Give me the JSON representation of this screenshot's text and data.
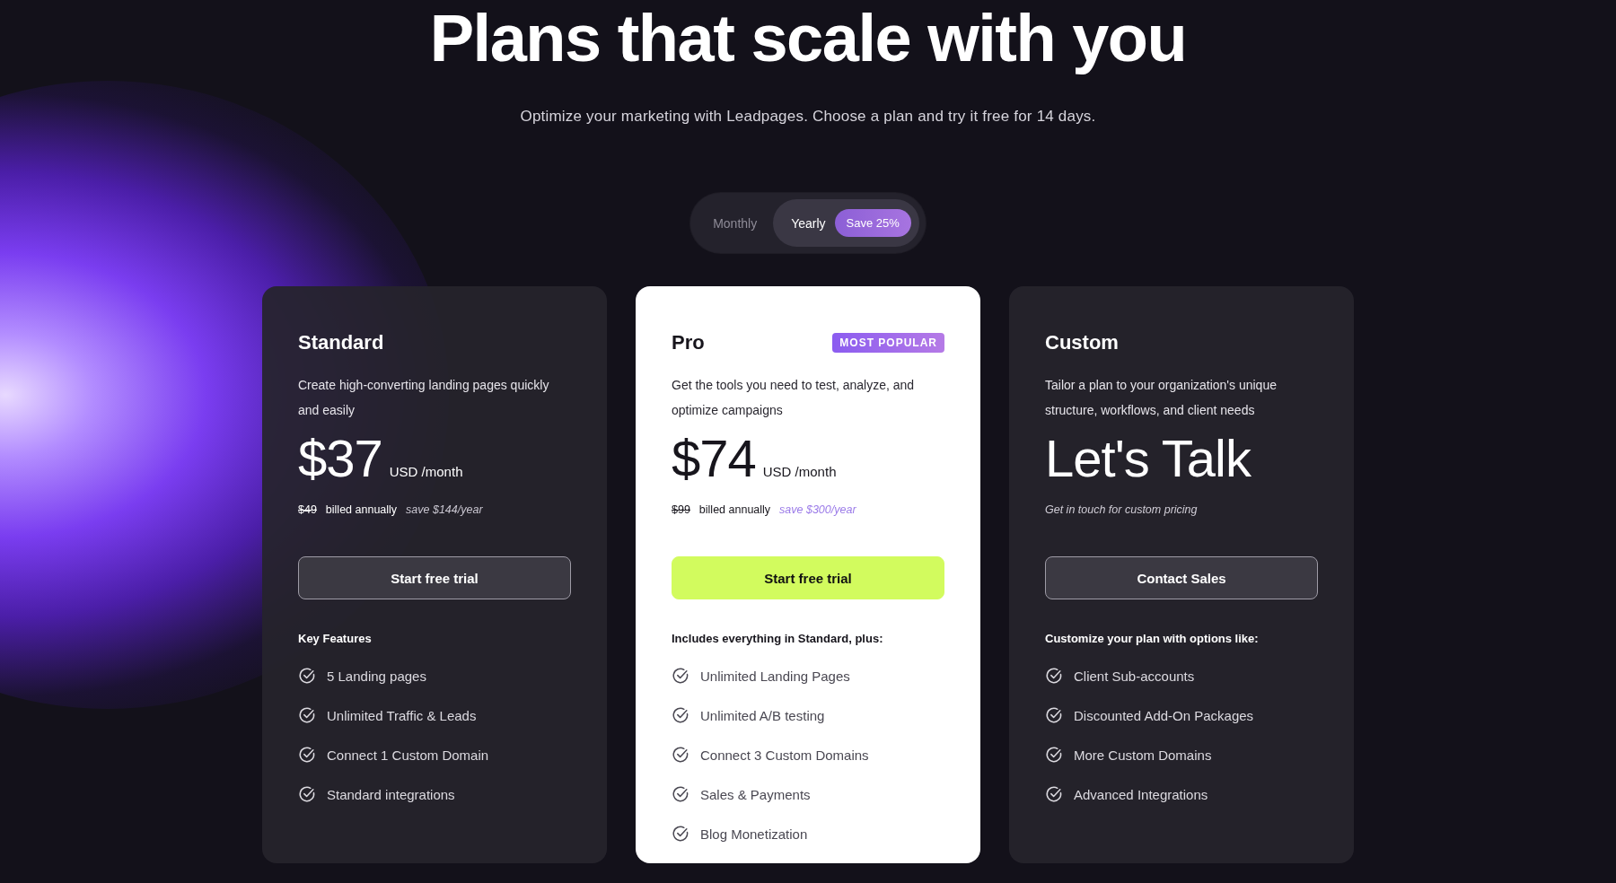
{
  "header": {
    "title": "Plans that scale with you",
    "subtitle": "Optimize your marketing with Leadpages. Choose a plan and try it free for 14 days."
  },
  "billing_toggle": {
    "options": [
      {
        "label": "Monthly",
        "selected": false
      },
      {
        "label": "Yearly",
        "selected": true
      }
    ],
    "badge": "Save 25%"
  },
  "plans": [
    {
      "kind": "priced",
      "featured": false,
      "name": "Standard",
      "description": "Create high-converting landing pages quickly and easily",
      "price": "$37",
      "price_unit": "USD /month",
      "original_price": "$49",
      "billing_note": "billed annually",
      "savings": "save $144/year",
      "cta": "Start free trial",
      "features_heading": "Key Features",
      "features": [
        "5 Landing pages",
        "Unlimited Traffic & Leads",
        "Connect 1 Custom Domain",
        "Standard integrations"
      ]
    },
    {
      "kind": "priced",
      "featured": true,
      "name": "Pro",
      "badge": "MOST POPULAR",
      "description": "Get the tools you need to test, analyze, and optimize campaigns",
      "price": "$74",
      "price_unit": "USD /month",
      "original_price": "$99",
      "billing_note": "billed annually",
      "savings": "save $300/year",
      "cta": "Start free trial",
      "features_heading": "Includes everything in Standard, plus:",
      "features": [
        "Unlimited Landing Pages",
        "Unlimited A/B testing",
        "Connect 3 Custom Domains",
        "Sales & Payments",
        "Blog Monetization"
      ]
    },
    {
      "kind": "contact",
      "featured": false,
      "name": "Custom",
      "description": "Tailor a plan to your organization's unique structure, workflows, and client needs",
      "price": "Let's Talk",
      "billing_note": "Get in touch for custom pricing",
      "cta": "Contact Sales",
      "features_heading": "Customize your plan with options like:",
      "features": [
        "Client Sub-accounts",
        "Discounted Add-On Packages",
        "More Custom Domains",
        "Advanced Integrations"
      ]
    }
  ]
}
